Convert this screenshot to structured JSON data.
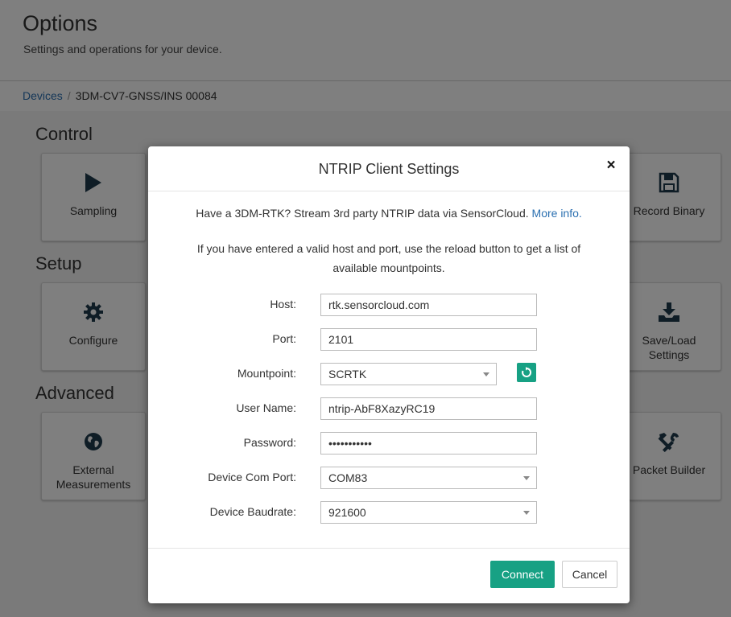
{
  "page": {
    "title": "Options",
    "subtitle": "Settings and operations for your device."
  },
  "breadcrumb": {
    "devices_link": "Devices",
    "separator": "/",
    "current": "3DM-CV7-GNSS/INS 00084"
  },
  "sections": {
    "control": "Control",
    "setup": "Setup",
    "advanced": "Advanced"
  },
  "tiles": {
    "sampling": "Sampling",
    "record_binary": "Record Binary",
    "configure": "Configure",
    "save_load_line1": "Save/Load",
    "save_load_line2": "Settings",
    "external_line1": "External",
    "external_line2": "Measurements",
    "packet_builder": "Packet Builder"
  },
  "modal": {
    "title": "NTRIP Client Settings",
    "close_glyph": "×",
    "intro_text": "Have a 3DM-RTK? Stream 3rd party NTRIP data via SensorCloud.",
    "intro_link": "More info.",
    "hint_line1": "If you have entered a valid host and port, use the reload button to get a list of",
    "hint_line2": "available mountpoints.",
    "fields": {
      "host_label": "Host:",
      "host_value": "rtk.sensorcloud.com",
      "port_label": "Port:",
      "port_value": "2101",
      "mountpoint_label": "Mountpoint:",
      "mountpoint_value": "SCRTK",
      "username_label": "User Name:",
      "username_value": "ntrip-AbF8XazyRC19",
      "password_label": "Password:",
      "password_value": "•••••••••••",
      "comport_label": "Device Com Port:",
      "comport_value": "COM83",
      "baudrate_label": "Device Baudrate:",
      "baudrate_value": "921600"
    },
    "connect_label": "Connect",
    "cancel_label": "Cancel"
  },
  "colors": {
    "accent": "#17a184",
    "link": "#2a6fb0",
    "icon_dark": "#1f3a4d"
  },
  "icons": {
    "sampling": "play-icon",
    "record_binary": "floppy-disk-icon",
    "configure": "gear-icon",
    "save_load": "download-tray-icon",
    "external": "globe-icon",
    "packet_builder": "tools-icon",
    "reload": "refresh-icon"
  }
}
